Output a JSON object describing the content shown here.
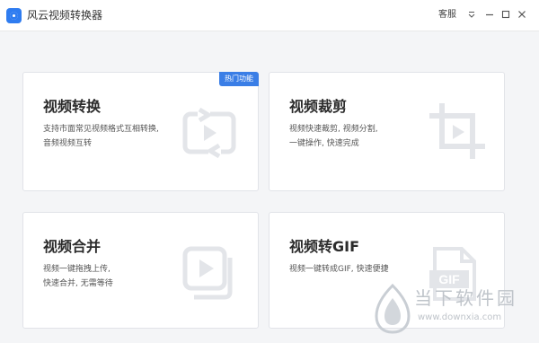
{
  "window": {
    "app_title": "风云视频转换器",
    "customer_service": "客服",
    "menu_icon": "menu-icon",
    "minimize_icon": "minimize-icon",
    "maximize_icon": "maximize-icon",
    "close_icon": "close-icon"
  },
  "cards": [
    {
      "title": "视频转换",
      "desc": [
        "支持市面常见视频格式互相转换,",
        "音频视频互转"
      ],
      "badge": "热门功能",
      "icon": "convert-icon"
    },
    {
      "title": "视频裁剪",
      "desc": [
        "视频快速裁剪, 视频分割,",
        "一键操作, 快速完成"
      ],
      "icon": "crop-icon"
    },
    {
      "title": "视频合并",
      "desc": [
        "视频一键拖拽上传,",
        "快速合并, 无需等待"
      ],
      "icon": "merge-icon"
    },
    {
      "title": "视频转GIF",
      "desc": [
        "视频一键转成GIF, 快速便捷"
      ],
      "icon": "gif-icon",
      "icon_label": "GIF"
    }
  ],
  "watermark": {
    "text": "当下软件园",
    "url": "www.downxia.com"
  },
  "colors": {
    "accent": "#3a7ee6",
    "icon_gray": "#e3e5e9"
  }
}
